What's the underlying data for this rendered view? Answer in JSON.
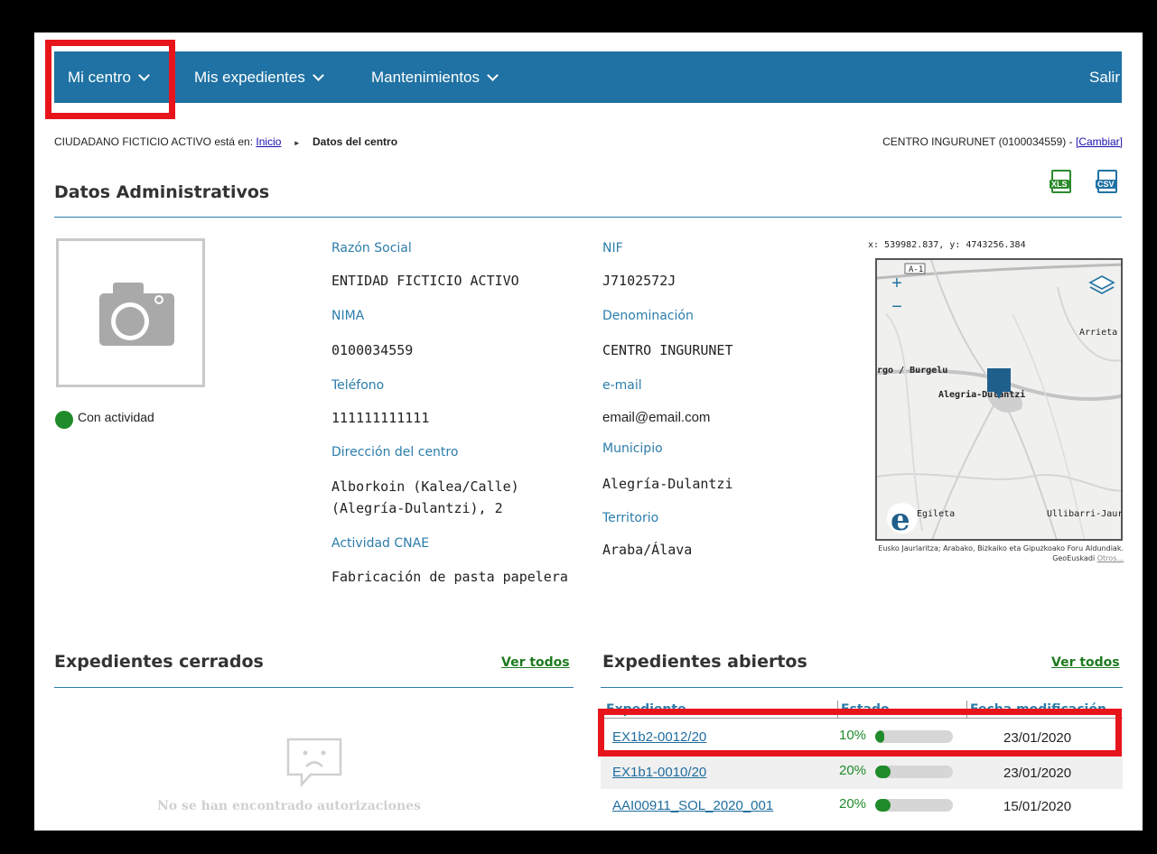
{
  "nav": {
    "items": [
      "Mi centro",
      "Mis expedientes",
      "Mantenimientos"
    ],
    "logout": "Salir"
  },
  "breadcrumb": {
    "prefix": "CIUDADANO FICTICIO ACTIVO está en:",
    "home": "Inicio",
    "current": "Datos del centro",
    "center": "CENTRO INGURUNET (0100034559) -",
    "change": "[Cambiar]"
  },
  "admin": {
    "title": "Datos Administrativos",
    "export_xls": "XLS",
    "export_csv": "CSV",
    "status": "Con actividad",
    "fields": {
      "razon_social_label": "Razón Social",
      "razon_social": "ENTIDAD FICTICIO ACTIVO",
      "nima_label": "NIMA",
      "nima": "0100034559",
      "telefono_label": "Teléfono",
      "telefono": "111111111111",
      "direccion_label": "Dirección del centro",
      "direccion_line1": "Alborkoin (Kalea/Calle)",
      "direccion_line2": "(Alegría-Dulantzi), 2",
      "cnae_label": "Actividad CNAE",
      "cnae": "Fabricación de pasta papelera",
      "nif_label": "NIF",
      "nif": "J7102572J",
      "denominacion_label": "Denominación",
      "denominacion": "CENTRO INGURUNET",
      "email_label": "e-mail",
      "email": "email@email.com",
      "municipio_label": "Municipio",
      "municipio": "Alegría-Dulantzi",
      "territorio_label": "Territorio",
      "territorio": "Araba/Álava"
    }
  },
  "map": {
    "coords": "x: 539982.837, y: 4743256.384",
    "road": "A-1",
    "places": [
      "Arrieta",
      "rgo / Burgelu",
      "Alegria-Dulantzi",
      "Egileta",
      "Ullibarri-Jaur"
    ],
    "attribution": "Eusko Jaurlaritza; Arabako, Bizkaiko eta Gipuzkoako Foru Aldundiak. GeoEuskadi",
    "attribution_link": "Otros..."
  },
  "closed": {
    "title": "Expedientes cerrados",
    "view_all": "Ver todos",
    "empty": "No se han encontrado autorizaciones"
  },
  "open": {
    "title": "Expedientes abiertos",
    "view_all": "Ver todos",
    "columns": [
      "Expediente",
      "Estado",
      "Fecha modificación"
    ],
    "rows": [
      {
        "id": "EX1b2-0012/20",
        "progress": "10%",
        "progress_value": 0.1,
        "date": "23/01/2020"
      },
      {
        "id": "EX1b1-0010/20",
        "progress": "20%",
        "progress_value": 0.2,
        "date": "23/01/2020"
      },
      {
        "id": "AAI00911_SOL_2020_001",
        "progress": "20%",
        "progress_value": 0.2,
        "date": "15/01/2020"
      }
    ]
  },
  "colors": {
    "nav": "#1f72a3",
    "highlight": "#e8141c",
    "accent": "#2b7dab",
    "green": "#1f8b2a"
  }
}
